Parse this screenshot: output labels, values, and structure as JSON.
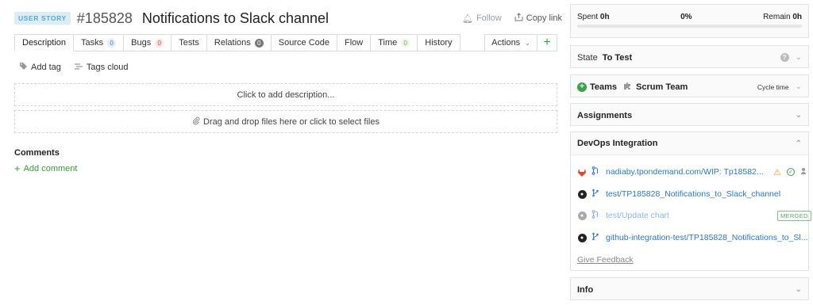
{
  "header": {
    "type_badge": "USER STORY",
    "id": "#185828",
    "title": "Notifications to Slack channel",
    "follow_label": "Follow",
    "copy_link_label": "Copy link"
  },
  "tabs": [
    {
      "label": "Description",
      "count": null
    },
    {
      "label": "Tasks",
      "count": "0",
      "count_style": "blue"
    },
    {
      "label": "Bugs",
      "count": "0",
      "count_style": "red"
    },
    {
      "label": "Tests",
      "count": null
    },
    {
      "label": "Relations",
      "count": "0",
      "count_style": "gray"
    },
    {
      "label": "Source Code",
      "count": null
    },
    {
      "label": "Flow",
      "count": null
    },
    {
      "label": "Time",
      "count": "0",
      "count_style": "green"
    },
    {
      "label": "History",
      "count": null
    }
  ],
  "actions_label": "Actions",
  "tags": {
    "add_tag": "Add tag",
    "tags_cloud": "Tags cloud"
  },
  "description_placeholder": "Click to add description...",
  "dropzone_text": "Drag and drop files here or click to select files",
  "comments": {
    "title": "Comments",
    "add_label": "Add comment"
  },
  "progress": {
    "spent_label": "Spent",
    "spent_value": "0h",
    "percent": "0%",
    "remain_label": "Remain",
    "remain_value": "0h",
    "fraction": 0
  },
  "state": {
    "label": "State",
    "value": "To Test"
  },
  "teams": {
    "label": "Teams",
    "team_name": "Scrum Team",
    "cycle_time_label": "Cycle time"
  },
  "assignments_label": "Assignments",
  "devops": {
    "title": "DevOps Integration",
    "items": [
      {
        "source": "gitlab-icon",
        "kind": "pull-request-icon",
        "text": "nadiaby.tpondemand.com/WIP: Tp18582...",
        "faded": false
      },
      {
        "source": "github-icon",
        "kind": "branch-icon",
        "text": "test/TP185828_Notifications_to_Slack_channel",
        "faded": false
      },
      {
        "source": "github-icon",
        "kind": "pull-request-icon",
        "text": "test/Update chart",
        "faded": true,
        "badge": "MERGED"
      },
      {
        "source": "github-icon",
        "kind": "branch-icon",
        "text": "github-integration-test/TP185828_Notifications_to_Sl...",
        "faded": false
      }
    ],
    "feedback_label": "Give Feedback"
  },
  "info_label": "Info",
  "colors": {
    "accent_green": "#3aa24a",
    "link_blue": "#2a78c8",
    "badge_bg": "#dbeef7"
  }
}
